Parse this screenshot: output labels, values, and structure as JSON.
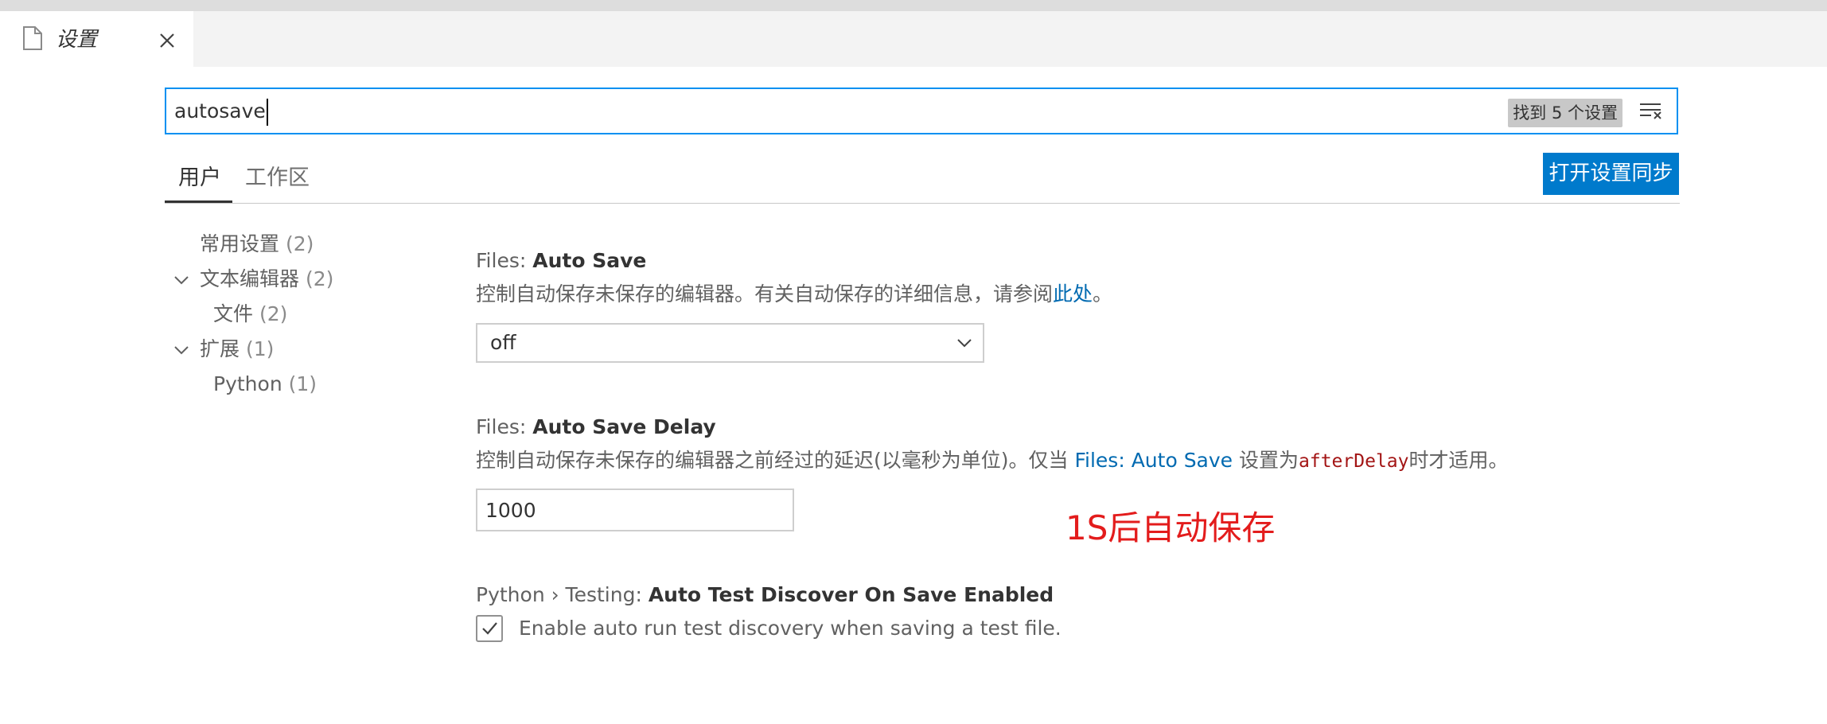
{
  "tab": {
    "title": "设置",
    "icons": {
      "file": "file-icon",
      "close": "close-icon"
    }
  },
  "search": {
    "value": "autosave",
    "result_badge": "找到 5 个设置",
    "icon": "clear-filter-icon"
  },
  "scopes": {
    "user": "用户",
    "workspace": "工作区",
    "sync_button": "打开设置同步"
  },
  "colors": {
    "accent": "#007acc",
    "focus_border": "#0090f1",
    "link": "#006ab1",
    "annotation": "#e31c1c",
    "code": "#a31515"
  },
  "toc": {
    "common": {
      "label": "常用设置",
      "count": "(2)"
    },
    "text_editor": {
      "label": "文本编辑器",
      "count": "(2)",
      "expanded": true
    },
    "files": {
      "label": "文件",
      "count": "(2)"
    },
    "extensions": {
      "label": "扩展",
      "count": "(1)",
      "expanded": true
    },
    "python": {
      "label": "Python",
      "count": "(1)"
    }
  },
  "settings": {
    "auto_save": {
      "category": "Files: ",
      "name": "Auto Save",
      "description": "控制自动保存未保存的编辑器。有关自动保存的详细信息，请参阅",
      "link": "此处",
      "suffix": "。",
      "value": "off"
    },
    "auto_save_delay": {
      "category": "Files: ",
      "name": "Auto Save Delay",
      "desc_pre": "控制自动保存未保存的编辑器之前经过的延迟(以毫秒为单位)。仅当 ",
      "desc_link": "Files: Auto Save",
      "desc_mid": " 设置为",
      "desc_code": "afterDelay",
      "desc_post": "时才适用。",
      "value": "1000"
    },
    "python_testing": {
      "category": "Python › Testing: ",
      "name": "Auto Test Discover On Save Enabled",
      "checkbox_label": "Enable auto run test discovery when saving a test file.",
      "checked": true
    }
  },
  "annotation": "1S后自动保存"
}
